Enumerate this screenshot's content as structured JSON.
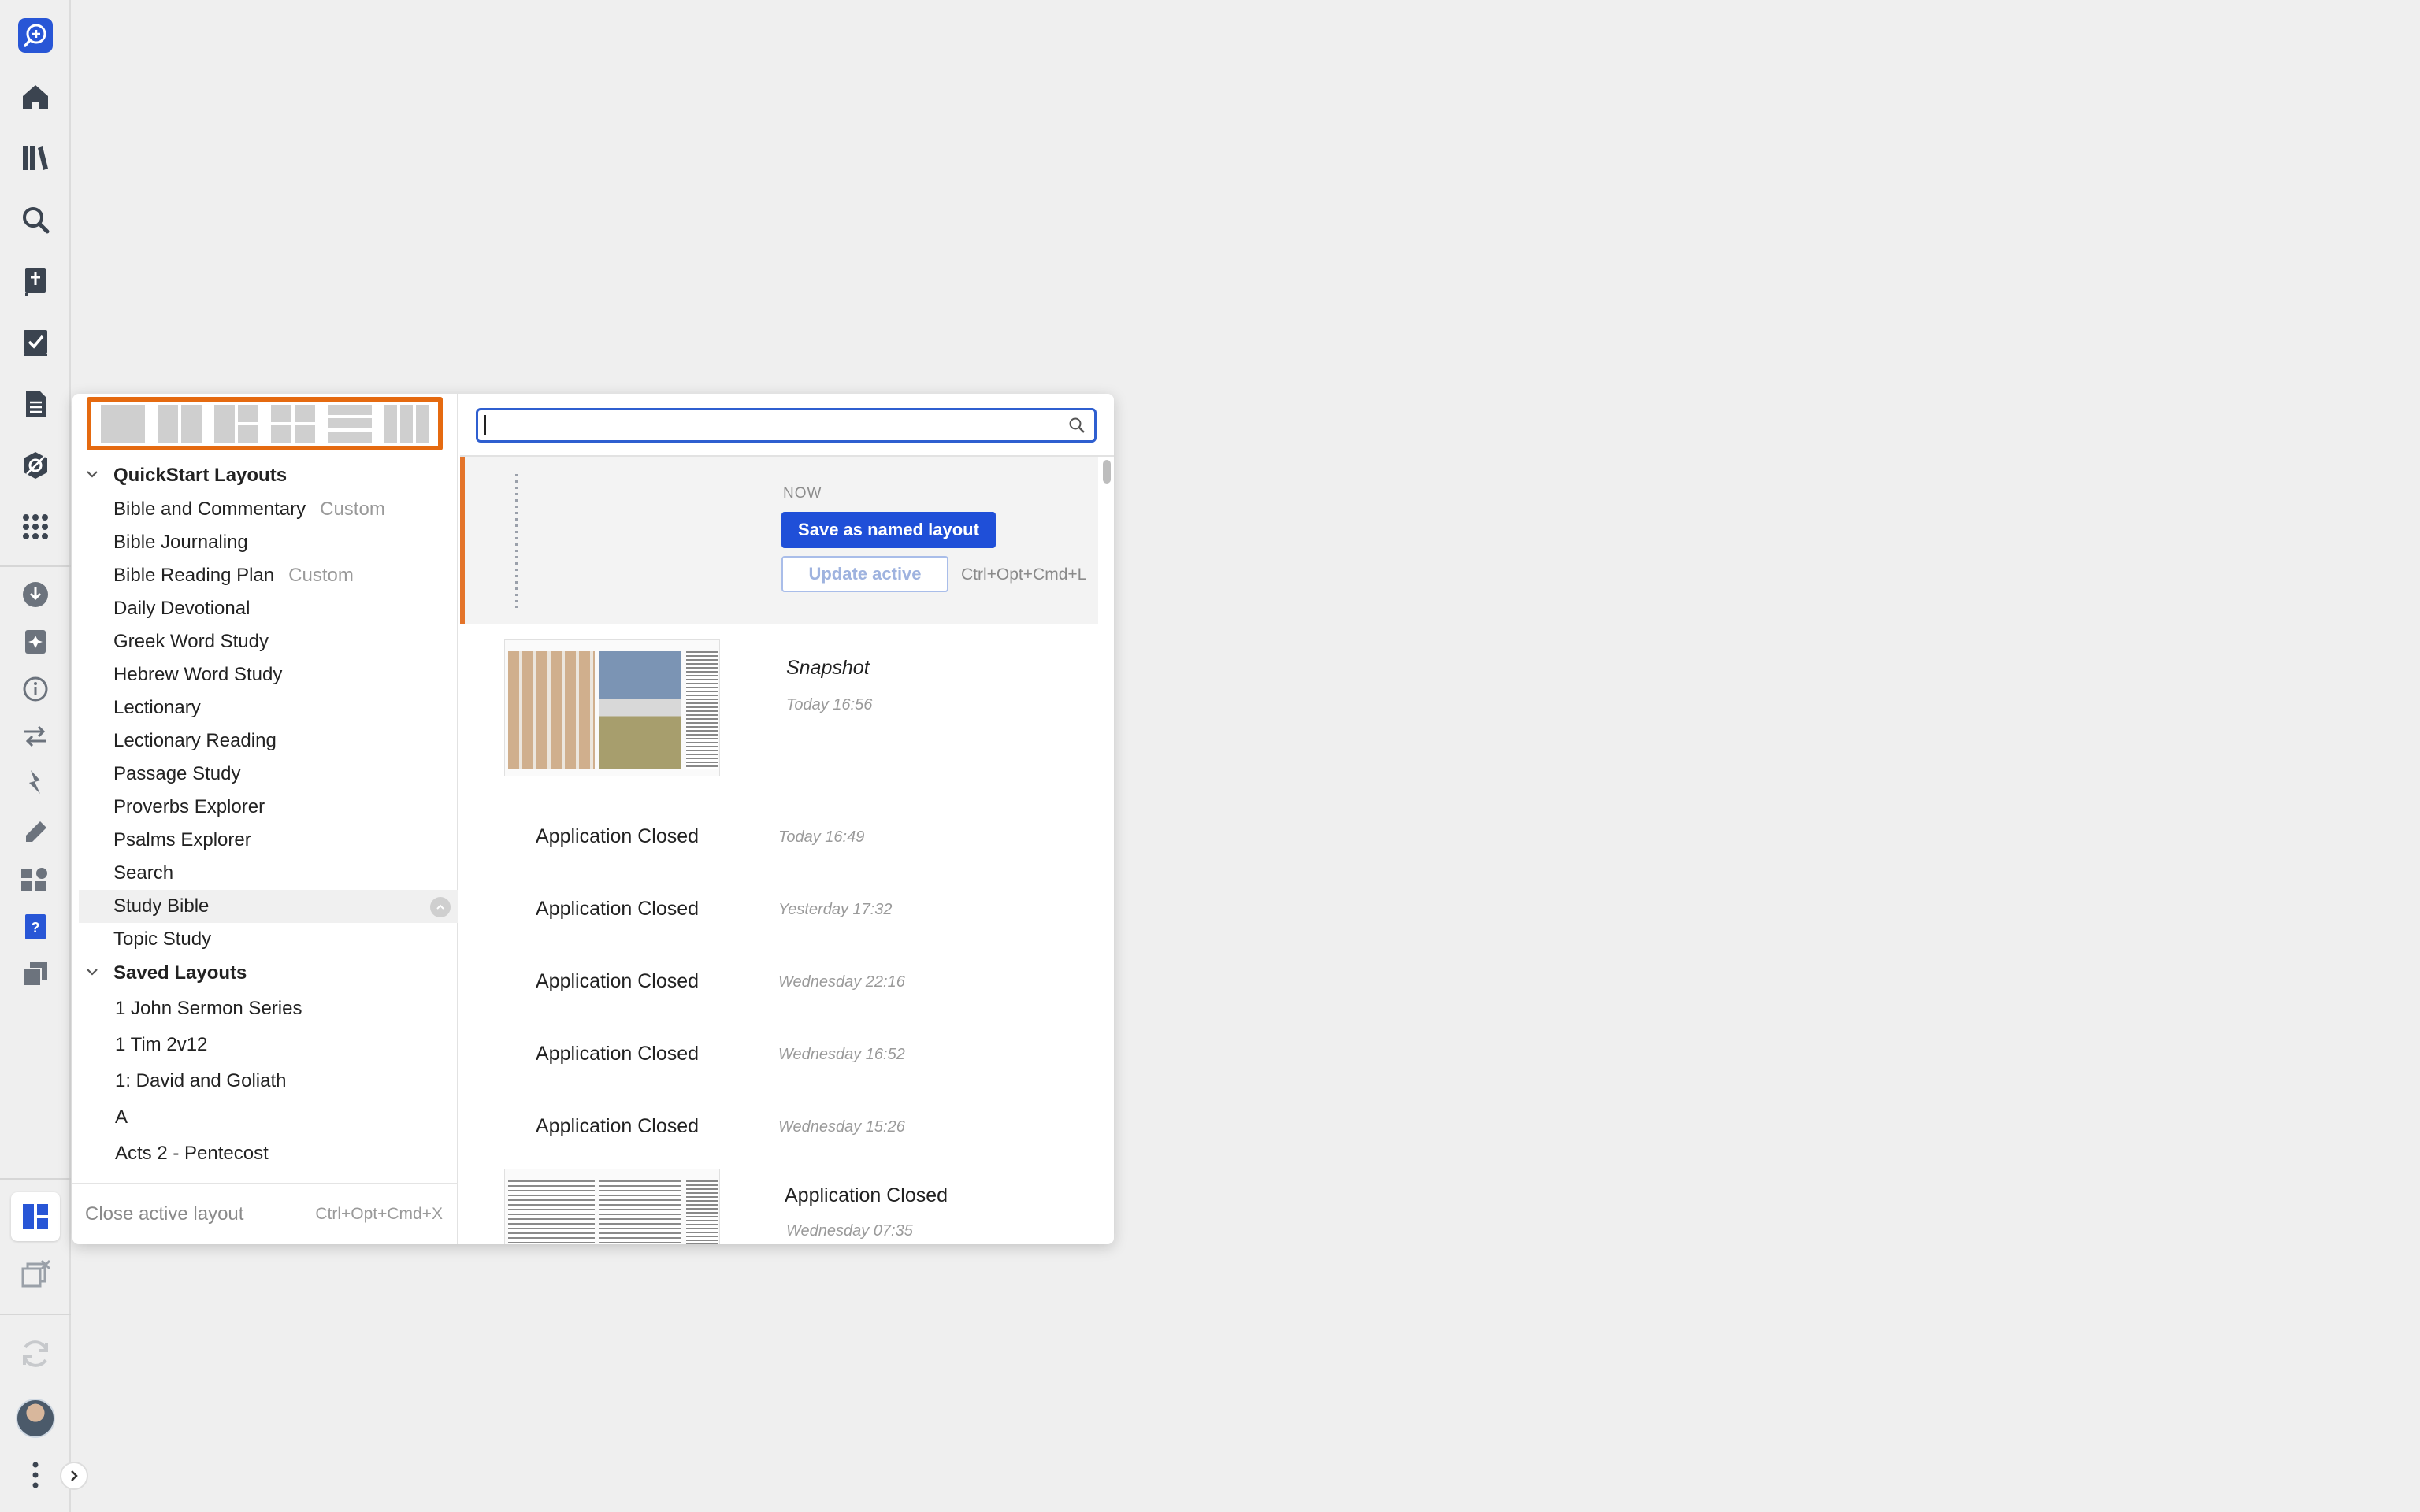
{
  "rail": {
    "items": [
      {
        "icon": "logos-search-icon"
      },
      {
        "icon": "home-icon"
      },
      {
        "icon": "library-icon"
      },
      {
        "icon": "search-icon"
      },
      {
        "icon": "bible-icon"
      },
      {
        "icon": "checklist-icon"
      },
      {
        "icon": "document-icon"
      },
      {
        "icon": "tools-icon"
      },
      {
        "icon": "apps-grid-icon"
      },
      {
        "icon": "download-icon"
      },
      {
        "icon": "factbook-icon"
      },
      {
        "icon": "info-icon"
      },
      {
        "icon": "transfer-icon"
      },
      {
        "icon": "bolt-icon"
      },
      {
        "icon": "highlight-pen-icon"
      },
      {
        "icon": "widgets-icon"
      },
      {
        "icon": "help-book-icon"
      },
      {
        "icon": "copy-icon"
      },
      {
        "icon": "layouts-icon"
      },
      {
        "icon": "close-layouts-icon"
      },
      {
        "icon": "sync-icon"
      },
      {
        "icon": "avatar"
      },
      {
        "icon": "more-vertical-icon"
      }
    ],
    "accent": "#2856d6"
  },
  "layouts_panel": {
    "search": {
      "placeholder": "",
      "value": ""
    },
    "quickstart": {
      "header": "QuickStart Layouts",
      "items": [
        {
          "label": "Bible and Commentary",
          "tag": "Custom"
        },
        {
          "label": "Bible Journaling",
          "tag": ""
        },
        {
          "label": "Bible Reading Plan",
          "tag": "Custom"
        },
        {
          "label": "Daily Devotional",
          "tag": ""
        },
        {
          "label": "Greek Word Study",
          "tag": ""
        },
        {
          "label": "Hebrew Word Study",
          "tag": ""
        },
        {
          "label": "Lectionary",
          "tag": ""
        },
        {
          "label": "Lectionary Reading",
          "tag": ""
        },
        {
          "label": "Passage Study",
          "tag": ""
        },
        {
          "label": "Proverbs Explorer",
          "tag": ""
        },
        {
          "label": "Psalms Explorer",
          "tag": ""
        },
        {
          "label": "Search",
          "tag": ""
        },
        {
          "label": "Study Bible",
          "tag": ""
        },
        {
          "label": "Topic Study",
          "tag": ""
        }
      ]
    },
    "saved": {
      "header": "Saved Layouts",
      "items": [
        {
          "label": "1 John Sermon Series"
        },
        {
          "label": "1 Tim 2v12"
        },
        {
          "label": "1: David and Goliath"
        },
        {
          "label": "A"
        },
        {
          "label": "Acts 2 - Pentecost"
        }
      ]
    },
    "close_active": {
      "label": "Close active layout",
      "shortcut": "Ctrl+Opt+Cmd+X"
    },
    "now": {
      "label": "NOW",
      "save_button": "Save as named layout",
      "update_button": "Update active",
      "update_shortcut": "Ctrl+Opt+Cmd+L"
    },
    "history": [
      {
        "title": "Snapshot",
        "time": "Today 16:56",
        "thumb": true
      },
      {
        "title": "Application Closed",
        "time": "Today 16:49"
      },
      {
        "title": "Application Closed",
        "time": "Yesterday 17:32"
      },
      {
        "title": "Application Closed",
        "time": "Wednesday 22:16"
      },
      {
        "title": "Application Closed",
        "time": "Wednesday 16:52"
      },
      {
        "title": "Application Closed",
        "time": "Wednesday 15:26"
      },
      {
        "title": "Application Closed",
        "time": "Wednesday 07:35",
        "thumb": true
      }
    ],
    "colors": {
      "highlight_border": "#e56a10",
      "primary_button": "#1f4fd8",
      "now_accent": "#e4742a"
    }
  }
}
